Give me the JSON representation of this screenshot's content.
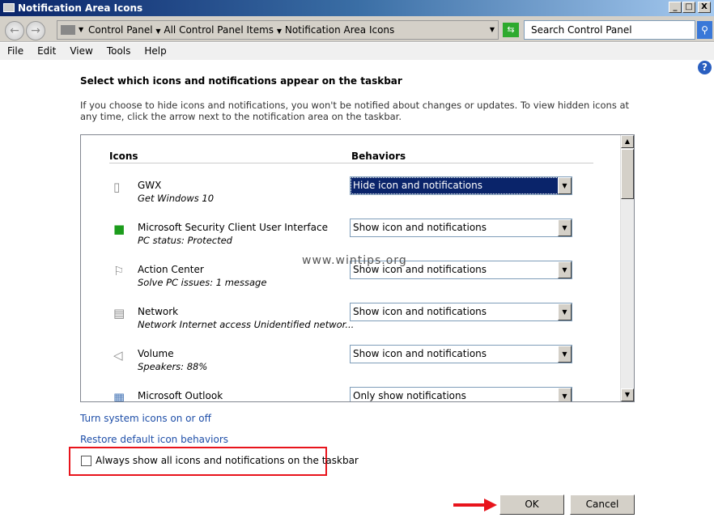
{
  "window": {
    "title": "Notification Area Icons",
    "minimize": "_",
    "maximize": "□",
    "close": "X"
  },
  "address": {
    "breadcrumb": [
      "Control Panel",
      "All Control Panel Items",
      "Notification Area Icons"
    ],
    "search_placeholder": "Search Control Panel"
  },
  "menu": [
    "File",
    "Edit",
    "View",
    "Tools",
    "Help"
  ],
  "main": {
    "heading": "Select which icons and notifications appear on the taskbar",
    "description": "If you choose to hide icons and notifications, you won't be notified about changes or updates. To view hidden icons at any time, click the arrow next to the notification area on the taskbar.",
    "col_icons": "Icons",
    "col_behaviors": "Behaviors",
    "rows": [
      {
        "name": "GWX",
        "sub": "Get Windows 10",
        "behavior": "Hide icon and notifications",
        "icon": "window-icon"
      },
      {
        "name": "Microsoft Security Client User Interface",
        "sub": "PC status: Protected",
        "behavior": "Show icon and notifications",
        "icon": "security-icon"
      },
      {
        "name": "Action Center",
        "sub": "Solve PC issues: 1 message",
        "behavior": "Show icon and notifications",
        "icon": "flag-icon"
      },
      {
        "name": "Network",
        "sub": "Network Internet access Unidentified networ...",
        "behavior": "Show icon and notifications",
        "icon": "network-icon"
      },
      {
        "name": "Volume",
        "sub": "Speakers: 88%",
        "behavior": "Show icon and notifications",
        "icon": "speaker-icon"
      },
      {
        "name": "Microsoft Outlook",
        "sub": "",
        "behavior": "Only show notifications",
        "icon": "outlook-icon"
      }
    ],
    "link_system_icons": "Turn system icons on or off",
    "link_restore": "Restore default icon behaviors",
    "checkbox_label": "Always show all icons and notifications on the taskbar",
    "checkbox_checked": false,
    "ok": "OK",
    "cancel": "Cancel",
    "watermark": "www.wintips.org"
  },
  "colors": {
    "highlight": "#e8141c",
    "selection": "#0a246a",
    "link": "#1e4ea8"
  }
}
